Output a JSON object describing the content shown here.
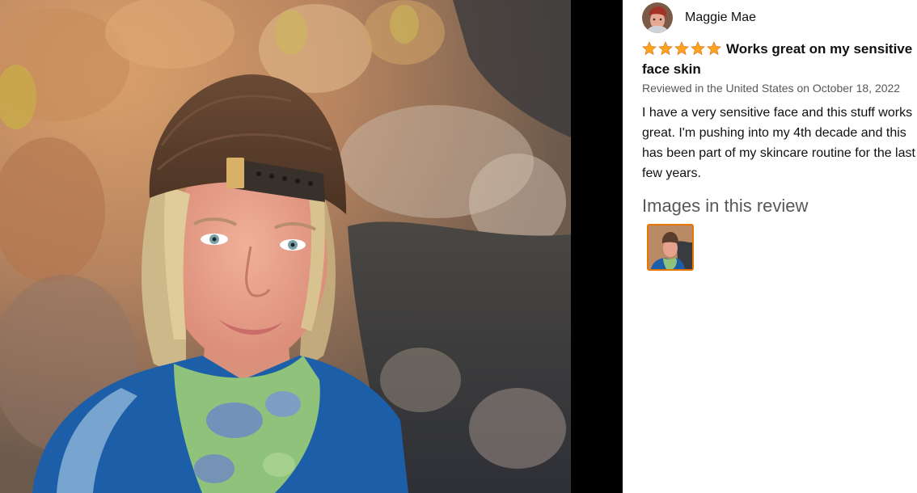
{
  "review": {
    "reviewer_name": "Maggie Mae",
    "rating": 5,
    "title": "Works great on my sensitive face skin",
    "meta": "Reviewed in the United States on October 18, 2022",
    "body": "I have a very sensitive face and this stuff works great. I'm pushing into my 4th decade and this has been part of my skincare routine for the last few years."
  },
  "images_section": {
    "heading": "Images in this review"
  },
  "colors": {
    "star": "#ffa41c",
    "thumb_border": "#e77600",
    "gutter": "#000000"
  }
}
